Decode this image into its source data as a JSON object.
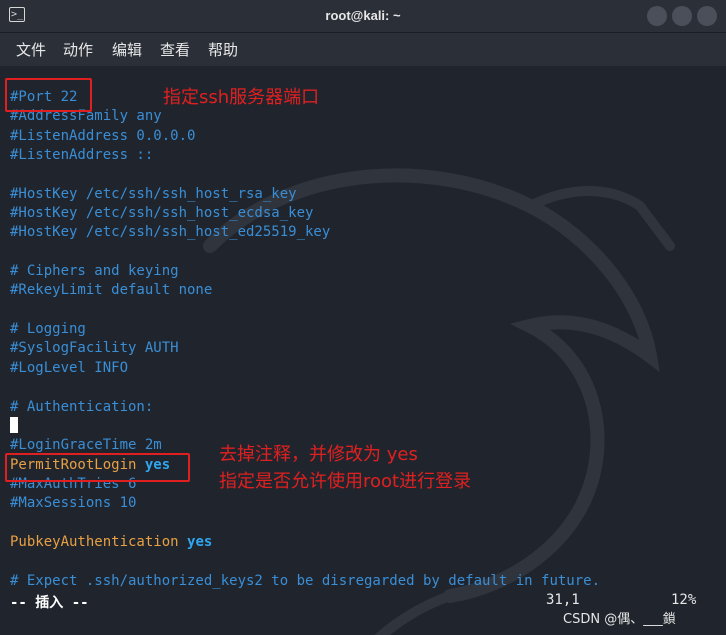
{
  "window": {
    "title": "root@kali: ~",
    "icon": "terminal-icon"
  },
  "menu": [
    "文件",
    "动作",
    "编辑",
    "查看",
    "帮助"
  ],
  "editor": {
    "lines": [
      {
        "text": "#Port 22",
        "style": "comment"
      },
      {
        "text": "#AddressFamily any",
        "style": "comment"
      },
      {
        "text": "#ListenAddress 0.0.0.0",
        "style": "comment"
      },
      {
        "text": "#ListenAddress ::",
        "style": "comment"
      },
      {
        "text": "",
        "style": "comment"
      },
      {
        "text": "#HostKey /etc/ssh/ssh_host_rsa_key",
        "style": "comment"
      },
      {
        "text": "#HostKey /etc/ssh/ssh_host_ecdsa_key",
        "style": "comment"
      },
      {
        "text": "#HostKey /etc/ssh/ssh_host_ed25519_key",
        "style": "comment"
      },
      {
        "text": "",
        "style": "comment"
      },
      {
        "text": "# Ciphers and keying",
        "style": "comment"
      },
      {
        "text": "#RekeyLimit default none",
        "style": "comment"
      },
      {
        "text": "",
        "style": "comment"
      },
      {
        "text": "# Logging",
        "style": "comment"
      },
      {
        "text": "#SyslogFacility AUTH",
        "style": "comment"
      },
      {
        "text": "#LogLevel INFO",
        "style": "comment"
      },
      {
        "text": "",
        "style": "comment"
      },
      {
        "text": "# Authentication:",
        "style": "comment"
      },
      {
        "text": "",
        "style": "cursor"
      },
      {
        "text": "#LoginGraceTime 2m",
        "style": "comment"
      },
      {
        "text": "PermitRootLogin",
        "value": "yes",
        "style": "directive"
      },
      {
        "text": "#MaxAuthTries 6",
        "style": "comment"
      },
      {
        "text": "#MaxSessions 10",
        "style": "comment"
      },
      {
        "text": "",
        "style": "comment"
      },
      {
        "text": "PubkeyAuthentication",
        "value": "yes",
        "style": "directive"
      },
      {
        "text": "",
        "style": "comment"
      },
      {
        "text": "# Expect .ssh/authorized_keys2 to be disregarded by default in future.",
        "style": "comment"
      }
    ]
  },
  "annotations": {
    "port_note": "指定ssh服务器端口",
    "root_note_1": "去掉注释，并修改为 yes",
    "root_note_2": "指定是否允许使用root进行登录"
  },
  "status": {
    "mode": "-- 插入 --",
    "position": "31,1",
    "percent": "12%"
  },
  "watermark": "CSDN @偶、___鎖",
  "colors": {
    "comment": "#3a8ed6",
    "directive": "#e8a043",
    "keyword": "#2fa6f0",
    "annotation": "#e02020"
  }
}
